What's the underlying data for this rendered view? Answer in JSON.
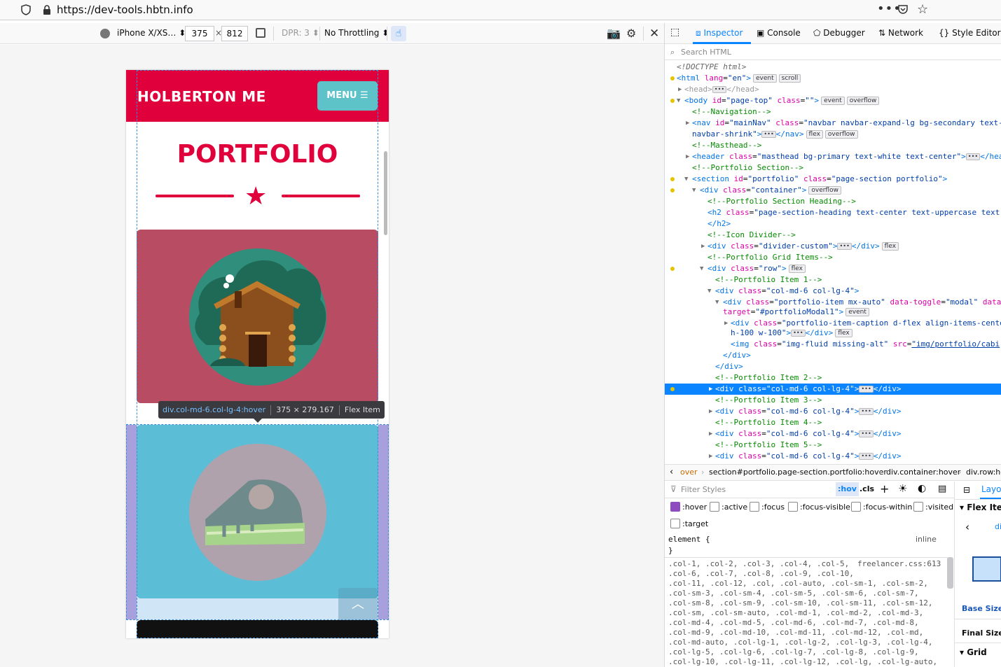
{
  "browser": {
    "url": "https://dev-tools.hbtn.info"
  },
  "rdm": {
    "device": "iPhone X/XS…",
    "width": "375",
    "height": "812",
    "times": "×",
    "dpr": "DPR: 3",
    "throttling": "No Throttling"
  },
  "page": {
    "brand": "HOLBERTON ME",
    "menu": "MENU ☰",
    "portfolio_title": "PORTFOLIO",
    "totop": "︿"
  },
  "tooltip": {
    "selector": "div.col-md-6.col-lg-4:hover",
    "size": "375 × 279.167",
    "type": "Flex Item"
  },
  "devtools": {
    "tabs": [
      "Inspector",
      "Console",
      "Debugger",
      "Network",
      "Style Editor"
    ],
    "search_placeholder": "Search HTML",
    "breadcrumbs": [
      "over",
      "section#portfolio.page-section.portfolio:hover",
      "div.container:hover",
      "div.row:ho"
    ],
    "filter_placeholder": "Filter Styles",
    "hov": ":hov",
    "cls": ".cls",
    "pseudo": [
      ":hover",
      ":active",
      ":focus",
      ":focus-visible",
      ":focus-within",
      ":visited",
      ":target"
    ],
    "element_rule": "element {",
    "element_close": "}",
    "inline": "inline",
    "rule_source": "freelancer.css:613",
    "rule_lines": [
      ".col-1, .col-2, .col-3, .col-4, .col-5,",
      ".col-6, .col-7, .col-8, .col-9, .col-10,",
      ".col-11, .col-12, .col, .col-auto, .col-sm-1, .col-sm-2,",
      ".col-sm-3, .col-sm-4, .col-sm-5, .col-sm-6, .col-sm-7,",
      ".col-sm-8, .col-sm-9, .col-sm-10, .col-sm-11, .col-sm-12,",
      ".col-sm, .col-sm-auto, .col-md-1, .col-md-2, .col-md-3,",
      ".col-md-4, .col-md-5, .col-md-6, .col-md-7, .col-md-8,",
      ".col-md-9, .col-md-10, .col-md-11, .col-md-12, .col-md,",
      ".col-md-auto, .col-lg-1, .col-lg-2, .col-lg-3, .col-lg-4,",
      ".col-lg-5, .col-lg-6, .col-lg-7, .col-lg-8, .col-lg-9,",
      ".col-lg-10, .col-lg-11, .col-lg-12, .col-lg, .col-lg-auto,"
    ],
    "layout": {
      "tab": "Layou",
      "flex_item": "Flex Item",
      "back": "di",
      "base_size": "Base Size",
      "final_size": "Final Size",
      "grid": "Grid"
    }
  }
}
